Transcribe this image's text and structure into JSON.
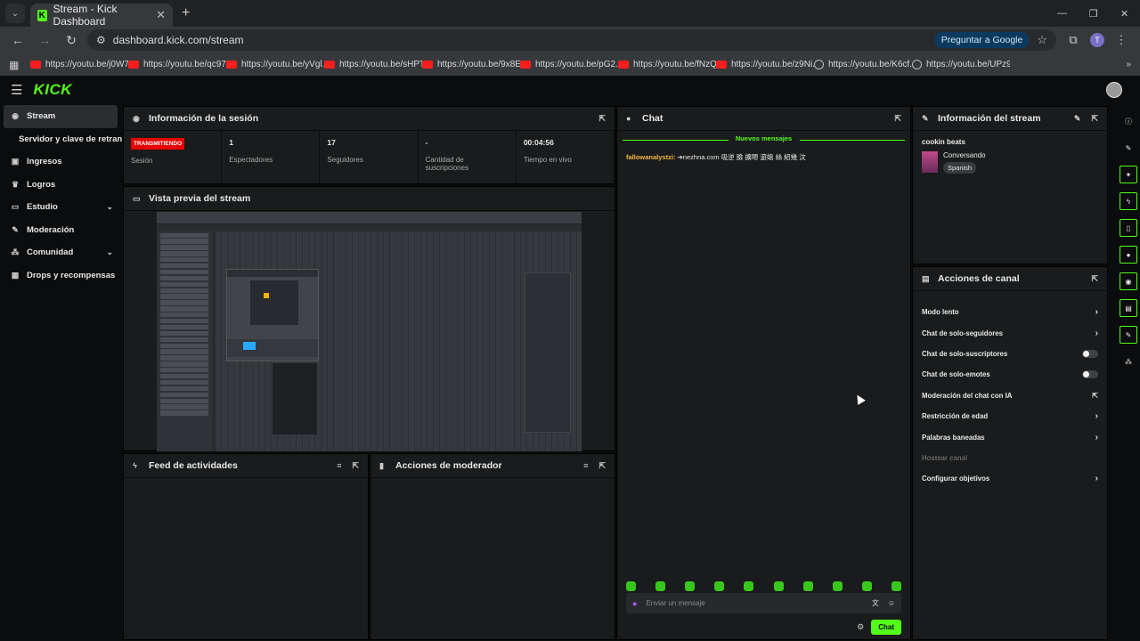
{
  "browser": {
    "tab_title": "Stream - Kick Dashboard",
    "tab_close": "✕",
    "new_tab": "+",
    "url": "dashboard.kick.com/stream",
    "ask_google": "Preguntar a Google",
    "profile_initial": "T",
    "bookmarks": [
      {
        "label": "https://youtu.be/j0W7...",
        "type": "youtube"
      },
      {
        "label": "https://youtu.be/qc97...",
        "type": "youtube"
      },
      {
        "label": "https://youtu.be/yVgl...",
        "type": "youtube"
      },
      {
        "label": "https://youtu.be/sHPT...",
        "type": "youtube"
      },
      {
        "label": "https://youtu.be/9x8E...",
        "type": "youtube"
      },
      {
        "label": "https://youtu.be/pG2...",
        "type": "youtube"
      },
      {
        "label": "https://youtu.be/fNzQ...",
        "type": "youtube"
      },
      {
        "label": "https://youtu.be/z9Ni...",
        "type": "youtube"
      },
      {
        "label": "https://youtu.be/K6cf...",
        "type": "globe"
      },
      {
        "label": "https://youtu.be/UPz9...",
        "type": "globe"
      }
    ]
  },
  "brand": {
    "logo": "KICK",
    "accent": "#53fc18",
    "live_red": "#e60000"
  },
  "sidebar": {
    "items": [
      {
        "label": "Stream",
        "icon": "broadcast-icon",
        "active": true
      },
      {
        "label": "Servidor y clave de retransmisión",
        "icon": "",
        "sub": true
      },
      {
        "label": "Ingresos",
        "icon": "wallet-icon"
      },
      {
        "label": "Logros",
        "icon": "trophy-icon"
      },
      {
        "label": "Estudio",
        "icon": "studio-icon",
        "expand": true
      },
      {
        "label": "Moderación",
        "icon": "wrench-icon"
      },
      {
        "label": "Comunidad",
        "icon": "community-icon",
        "expand": true
      },
      {
        "label": "Drops y recompensas",
        "icon": "gift-icon"
      }
    ]
  },
  "session": {
    "title": "Información de la sesión",
    "badge": "TRANSMITIENDO",
    "cells": [
      {
        "value": "",
        "label": "Sesión"
      },
      {
        "value": "1",
        "label": "Espectadores"
      },
      {
        "value": "17",
        "label": "Seguidores"
      },
      {
        "value": "-",
        "label": "Cantidad de suscripciones"
      },
      {
        "value": "00:04:56",
        "label": "Tiempo en vivo"
      }
    ]
  },
  "preview": {
    "title": "Vista previa del stream"
  },
  "activity": {
    "title": "Feed de actividades"
  },
  "modactions": {
    "title": "Acciones de moderador"
  },
  "chat": {
    "title": "Chat",
    "new_messages": "Nuevos mensajes",
    "messages": [
      {
        "user": "fallowanalystzi:",
        "text": " ➔nezhna.com 吸逆 臉 擴嗯 遊嬉 絲 紹幾 汶"
      }
    ],
    "input_placeholder": "Enviar un mensaje",
    "send_label": "Chat"
  },
  "stream_info": {
    "title": "Información del stream",
    "stream_title": "cookin beats",
    "category": "Conversando",
    "language": "Spanish"
  },
  "channel_actions": {
    "title": "Acciones de canal",
    "items": [
      {
        "label": "Modo lento",
        "control": "arrow"
      },
      {
        "label": "Chat de solo-seguidores",
        "control": "arrow"
      },
      {
        "label": "Chat de solo-suscriptores",
        "control": "toggle",
        "on": false
      },
      {
        "label": "Chat de solo-emotes",
        "control": "toggle",
        "on": false
      },
      {
        "label": "Moderación del chat con IA",
        "control": "external"
      },
      {
        "label": "Restricción de edad",
        "control": "arrow"
      },
      {
        "label": "Palabras baneadas",
        "control": "arrow"
      },
      {
        "label": "Hostear canal",
        "control": "none",
        "disabled": true
      },
      {
        "label": "Configurar objetivos",
        "control": "arrow"
      }
    ]
  }
}
